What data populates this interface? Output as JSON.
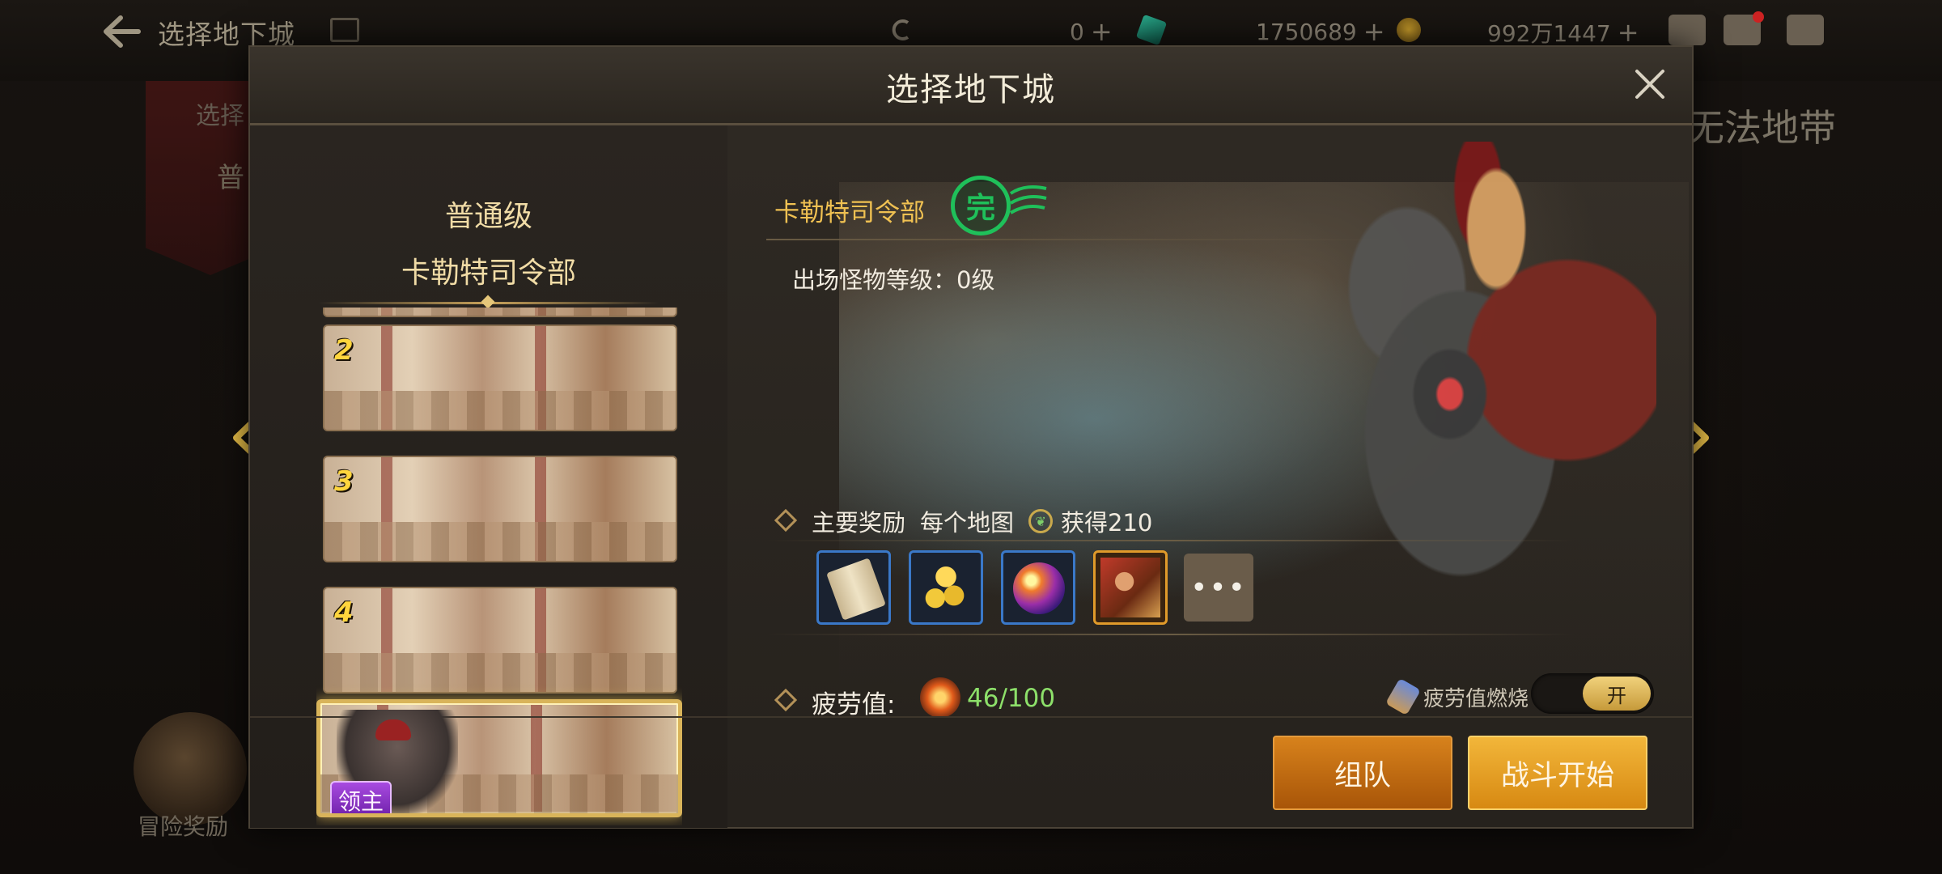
{
  "topbar": {
    "title": "选择地下城",
    "currencies": [
      {
        "value": "0",
        "icon": "crystal-icon",
        "plus": "+"
      },
      {
        "value": "1750689",
        "icon": "gem-icon",
        "plus": "+"
      },
      {
        "value": "992万1447",
        "icon": "gold-coin-icon",
        "plus": "+"
      }
    ]
  },
  "background": {
    "left_banner_top": "选择",
    "left_banner_bottom": "普",
    "right_text": "无法地带",
    "adventure_reward": "冒险奖励"
  },
  "modal": {
    "title": "选择地下城",
    "difficulty": "普通级",
    "dungeon": "卡勒特司令部",
    "stages": [
      {
        "num": "2"
      },
      {
        "num": "3"
      },
      {
        "num": "4"
      },
      {
        "num": "",
        "badge": "领主"
      }
    ],
    "detail": {
      "dungeon_name": "卡勒特司令部",
      "complete_stamp": "完",
      "monster_level": "出场怪物等级：0级",
      "reward_title": "主要奖励",
      "reward_per_map": "每个地图",
      "reward_gain": "获得210",
      "reward_items": [
        "scroll-icon",
        "gold-coins-icon",
        "orb-icon",
        "avatar-icon"
      ],
      "more": "•••",
      "fatigue_label": "疲劳值:",
      "fatigue_value": "46/100",
      "burn_label": "疲劳值燃烧",
      "toggle_on": "开"
    },
    "buttons": {
      "team": "组队",
      "start": "战斗开始"
    }
  },
  "colors": {
    "accent_gold": "#f0c152",
    "fatigue_green": "#8de06a",
    "complete_green": "#1fc05a",
    "team_button": "#d7821c",
    "start_button": "#f2b63a"
  }
}
